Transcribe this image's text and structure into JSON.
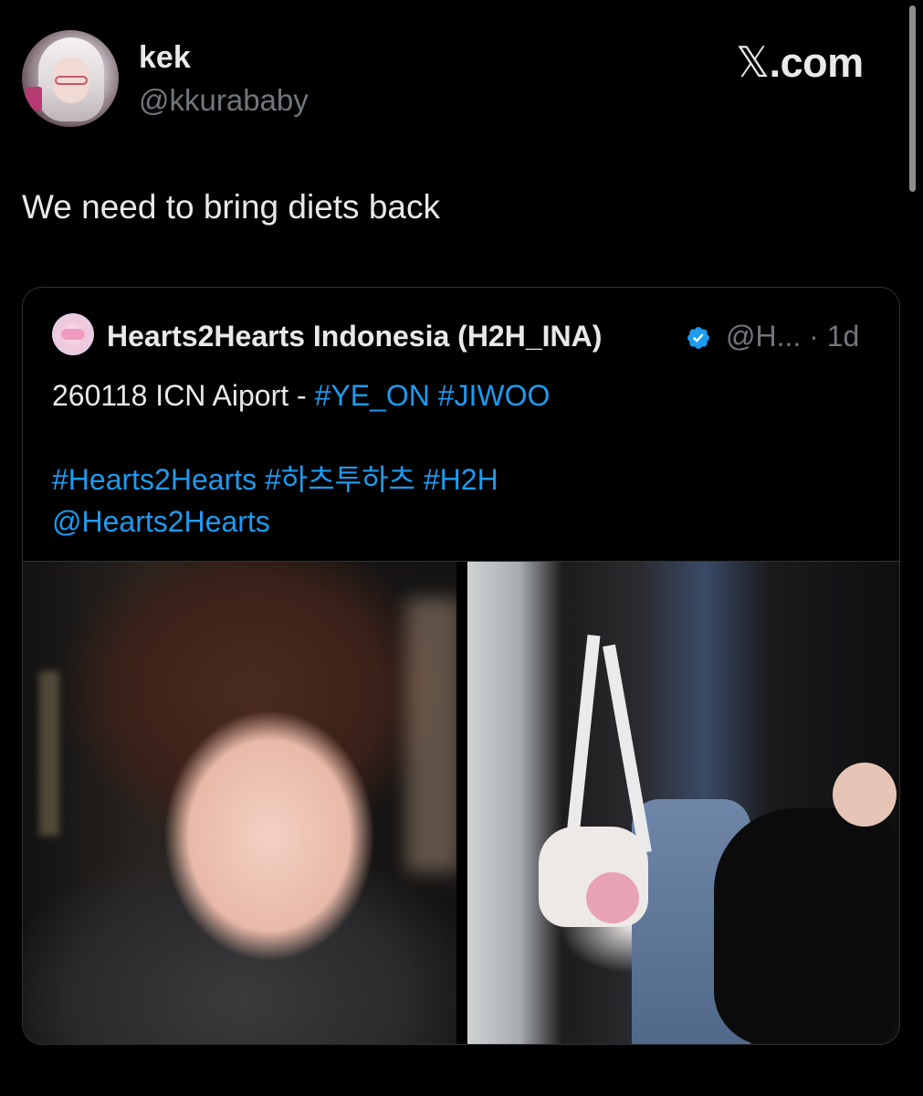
{
  "author": {
    "display_name": "kek",
    "handle": "@kkurababy"
  },
  "brand": {
    "logo_glyph": "𝕏",
    "domain_suffix": ".com"
  },
  "tweet": {
    "text": "We need to bring diets back"
  },
  "quoted": {
    "name": "Hearts2Hearts Indonesia (H2H_INA)",
    "handle": "@H...",
    "time": "· 1d",
    "line1_prefix": "260118 ICN Aiport - ",
    "line1_tags": [
      "#YE_ON",
      "#JIWOO"
    ],
    "line2_tags": [
      "#Hearts2Hearts",
      "#하츠투하츠",
      "#H2H"
    ],
    "line3_mention": "@Hearts2Hearts"
  },
  "colors": {
    "background": "#000000",
    "text": "#e7e9ea",
    "secondary": "#71767b",
    "link": "#1d9bf0",
    "verified": "#1d9bf0",
    "border": "#2f3336"
  },
  "icons": {
    "verified": "verified-badge-icon"
  }
}
